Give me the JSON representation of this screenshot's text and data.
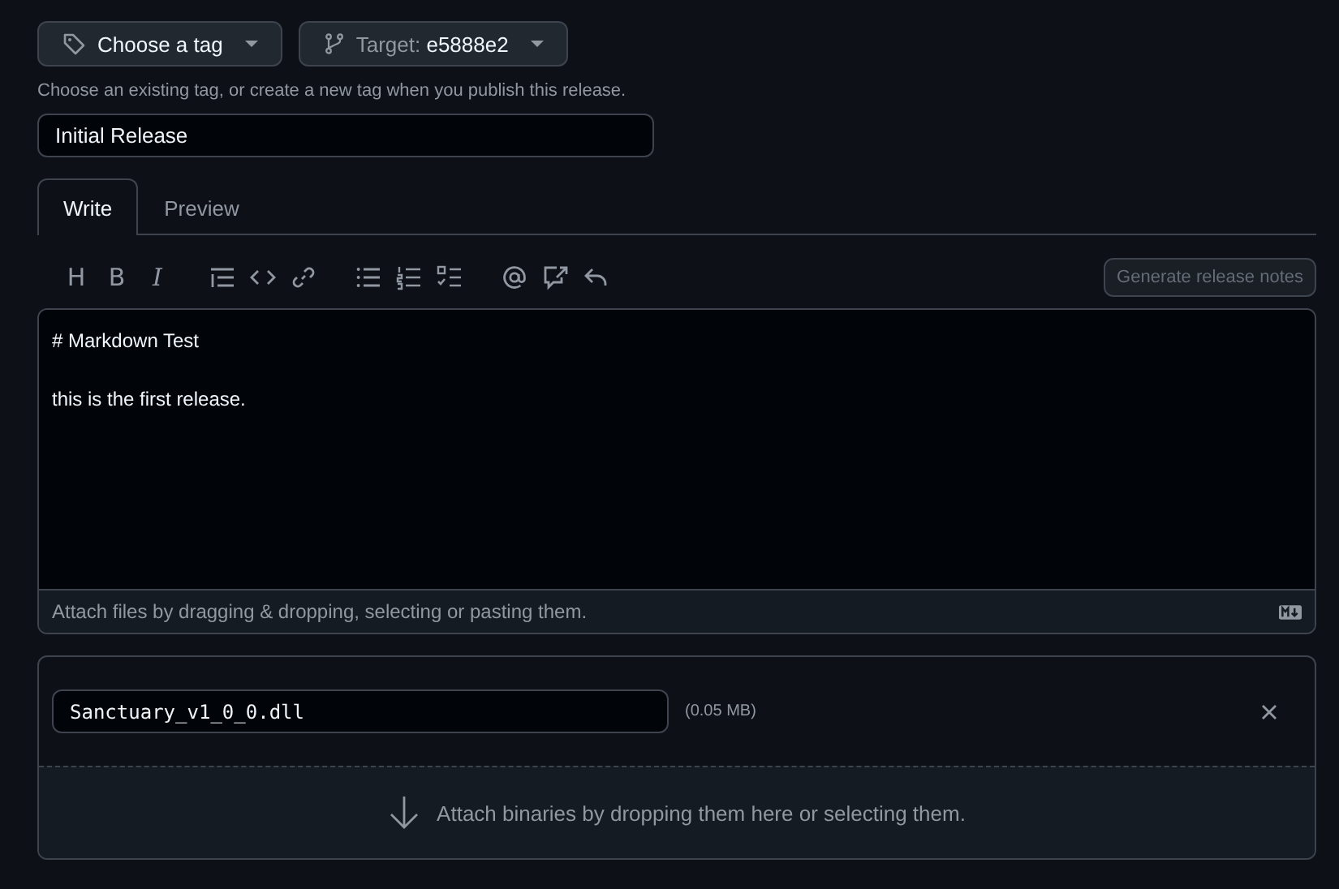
{
  "tag_button": {
    "label": "Choose a tag"
  },
  "target_button": {
    "label": "Target:",
    "value": "e5888e2"
  },
  "tag_hint": "Choose an existing tag, or create a new tag when you publish this release.",
  "title_field": {
    "value": "Initial Release"
  },
  "tabs": [
    {
      "label": "Write",
      "selected": true
    },
    {
      "label": "Preview",
      "selected": false
    }
  ],
  "toolbar": [
    [
      {
        "kind": "glyph",
        "text": "H"
      },
      {
        "kind": "glyph",
        "text": "B"
      },
      {
        "kind": "italic",
        "text": "I"
      }
    ],
    [
      {
        "kind": "quote"
      },
      {
        "kind": "code"
      },
      {
        "kind": "link"
      }
    ],
    [
      {
        "kind": "bullets"
      },
      {
        "kind": "numbers"
      },
      {
        "kind": "tasks"
      }
    ],
    [
      {
        "kind": "mention"
      },
      {
        "kind": "reference"
      },
      {
        "kind": "reply"
      }
    ]
  ],
  "generate_button": {
    "label": "Generate release notes",
    "disabled": true
  },
  "body": [
    "# Markdown Test",
    "this is the first release."
  ],
  "attach_hint": "Attach files by dragging & dropping, selecting or pasting them.",
  "assets": [
    {
      "name": "Sanctuary_v1_0_0.dll",
      "size": "(0.05 MB)"
    }
  ],
  "dropzone": "Attach binaries by dropping them here or selecting them."
}
